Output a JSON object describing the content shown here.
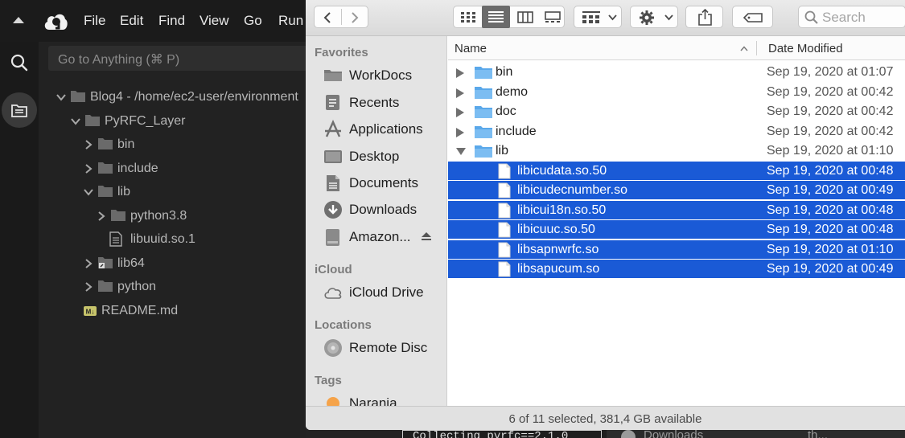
{
  "ide": {
    "menu": [
      "File",
      "Edit",
      "Find",
      "View",
      "Go",
      "Run"
    ],
    "goto_placeholder": "Go to Anything (⌘ P)",
    "tree": [
      {
        "label": "Blog4 - /home/ec2-user/environment",
        "kind": "folder",
        "state": "open"
      },
      {
        "label": "PyRFC_Layer",
        "kind": "folder",
        "state": "open"
      },
      {
        "label": "bin",
        "kind": "folder",
        "state": "closed"
      },
      {
        "label": "include",
        "kind": "folder",
        "state": "closed"
      },
      {
        "label": "lib",
        "kind": "folder",
        "state": "open"
      },
      {
        "label": "python3.8",
        "kind": "folder",
        "state": "closed"
      },
      {
        "label": "libuuid.so.1",
        "kind": "file"
      },
      {
        "label": "lib64",
        "kind": "folder-link",
        "state": "closed"
      },
      {
        "label": "python",
        "kind": "folder",
        "state": "closed"
      },
      {
        "label": "README.md",
        "kind": "markdown"
      }
    ]
  },
  "finder": {
    "search_placeholder": "Search",
    "sidebar": {
      "favorites_heading": "Favorites",
      "favorites": [
        {
          "label": "WorkDocs",
          "icon": "folder-icon"
        },
        {
          "label": "Recents",
          "icon": "recents-icon"
        },
        {
          "label": "Applications",
          "icon": "applications-icon"
        },
        {
          "label": "Desktop",
          "icon": "desktop-icon"
        },
        {
          "label": "Documents",
          "icon": "documents-icon"
        },
        {
          "label": "Downloads",
          "icon": "downloads-icon"
        },
        {
          "label": "Amazon...",
          "icon": "drive-icon"
        }
      ],
      "icloud_heading": "iCloud",
      "icloud": [
        {
          "label": "iCloud Drive",
          "icon": "cloud-icon"
        }
      ],
      "locations_heading": "Locations",
      "locations": [
        {
          "label": "Remote Disc",
          "icon": "disc-icon"
        }
      ],
      "tags_heading": "Tags",
      "tags": [
        {
          "label": "Naranja",
          "color": "#f5a34a"
        }
      ]
    },
    "columns": {
      "name": "Name",
      "date": "Date Modified"
    },
    "rows": [
      {
        "name": "bin",
        "date": "Sep 19, 2020 at 01:07",
        "kind": "folder",
        "selected": false
      },
      {
        "name": "demo",
        "date": "Sep 19, 2020 at 00:42",
        "kind": "folder",
        "selected": false
      },
      {
        "name": "doc",
        "date": "Sep 19, 2020 at 00:42",
        "kind": "folder",
        "selected": false
      },
      {
        "name": "include",
        "date": "Sep 19, 2020 at 00:42",
        "kind": "folder",
        "selected": false
      },
      {
        "name": "lib",
        "date": "Sep 19, 2020 at 01:10",
        "kind": "folder-open",
        "selected": false
      },
      {
        "name": "libicudata.so.50",
        "date": "Sep 19, 2020 at 00:48",
        "kind": "file",
        "selected": true
      },
      {
        "name": "libicudecnumber.so",
        "date": "Sep 19, 2020 at 00:49",
        "kind": "file",
        "selected": true
      },
      {
        "name": "libicui18n.so.50",
        "date": "Sep 19, 2020 at 00:48",
        "kind": "file",
        "selected": true
      },
      {
        "name": "libicuuc.so.50",
        "date": "Sep 19, 2020 at 00:48",
        "kind": "file",
        "selected": true
      },
      {
        "name": "libsapnwrfc.so",
        "date": "Sep 19, 2020 at 01:10",
        "kind": "file",
        "selected": true
      },
      {
        "name": "libsapucum.so",
        "date": "Sep 19, 2020 at 00:49",
        "kind": "file",
        "selected": true
      }
    ],
    "status": "6 of 11 selected, 381,4 GB available"
  },
  "background": {
    "terminal_text": "Collecting pyrfc==2.1.0",
    "downloads_label": "Downloads",
    "folder_label": "th..."
  },
  "colors": {
    "selection": "#1a5ad6",
    "folder": "#5aa8ea",
    "ide_bg": "#222222"
  }
}
